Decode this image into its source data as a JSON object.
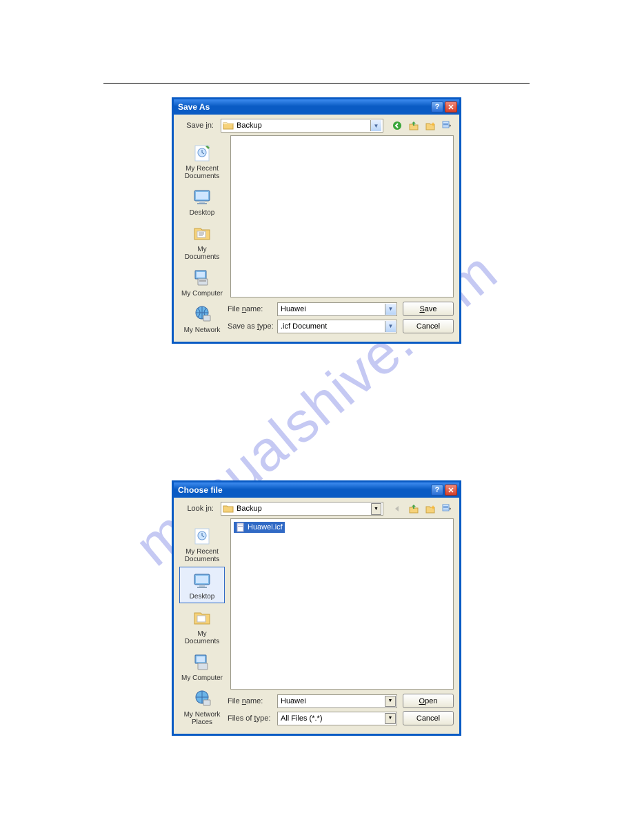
{
  "watermark": "manualshive.com",
  "dialog1": {
    "title": "Save As",
    "location_label": "Save in:",
    "location_value": "Backup",
    "sidebar": [
      {
        "label": "My Recent Documents"
      },
      {
        "label": "Desktop"
      },
      {
        "label": "My Documents"
      },
      {
        "label": "My Computer"
      },
      {
        "label": "My Network"
      }
    ],
    "file_name_label": "File name:",
    "file_name_value": "Huawei",
    "save_type_label": "Save as type:",
    "save_type_value": ".icf Document",
    "primary_button": "Save",
    "cancel_button": "Cancel"
  },
  "dialog2": {
    "title": "Choose file",
    "location_label": "Look in:",
    "location_value": "Backup",
    "file_item": "Huawei.icf",
    "sidebar": [
      {
        "label": "My Recent Documents"
      },
      {
        "label": "Desktop"
      },
      {
        "label": "My Documents"
      },
      {
        "label": "My Computer"
      },
      {
        "label": "My Network Places"
      }
    ],
    "file_name_label": "File name:",
    "file_name_value": "Huawei",
    "files_type_label": "Files of type:",
    "files_type_value": "All Files (*.*)",
    "primary_button": "Open",
    "cancel_button": "Cancel"
  }
}
